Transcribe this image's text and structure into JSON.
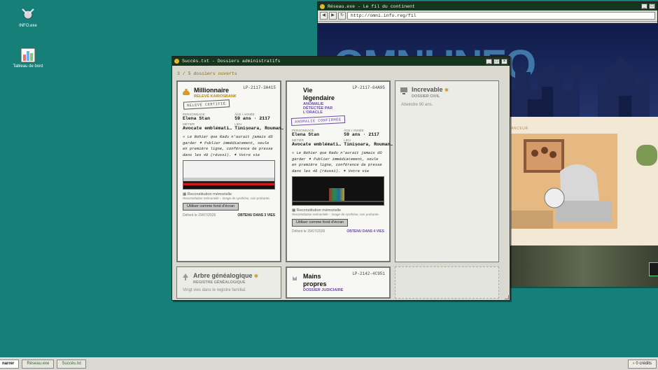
{
  "desktop": {
    "icons": [
      {
        "label": "INFO.exe"
      },
      {
        "label": "Tableau de bord"
      }
    ]
  },
  "browser": {
    "title": "Réseau.exe - Le fil du continent",
    "url": "http://omni.info.reg/fil",
    "banner": "OMNI INFO",
    "section": "ANCEUR"
  },
  "success_window": {
    "title": "Succès.txt - Dossiers administratifs",
    "count_text": "3 / 5 dossiers ouverts",
    "cards": [
      {
        "title": "Millionnaire",
        "id": "LP-2117-3A415",
        "subtitle": "RELEVÉ KAIROSBANK",
        "stamp": "RELEVÉ CERTIFIÉ",
        "labels": [
          "PERSONNAGE",
          "ÂGE / ANNÉE",
          "MÉTIER",
          "LIEU"
        ],
        "character": "Elena Stan",
        "age": "59 ans · 2117",
        "job": "Avocate emblémati…",
        "place": "Timișoara, Rouman…",
        "quote": "« Le Bohier que Radu n'aurait jamais dû garder ✦ Publier immédiatement, seule en première ligne, conférence de presse dans les 48 (réussi). ✦ Votre vie bascule - »",
        "recon_title": "Reconstitution mémorielle",
        "recon_desc": "Reconstitution mémorielle – image de synthèse, non probante.",
        "button": "Utiliser comme fond d'écran",
        "date": "Délivré le 29/07/2026",
        "obtained": "OBTENU DANS 3 VIES"
      },
      {
        "title": "Vie légendaire",
        "id": "LP-2117-64A95",
        "subtitle": "ANOMALIE DÉTECTÉE PAR L'ORACLE",
        "stamp": "ANOMALIE CONFIRMÉE",
        "labels": [
          "PERSONNAGE",
          "ÂGE / ANNÉE",
          "MÉTIER",
          "LIEU"
        ],
        "character": "Elena Stan",
        "age": "59 ans · 2117",
        "job": "Avocate emblémati…",
        "place": "Timișoara, Rouman…",
        "quote": "« Le Bohier que Radu n'aurait jamais dû garder ✦ Publier immédiatement, seule en première ligne, conférence de presse dans les 48 (réussi). ✦ Votre vie bascule - »",
        "recon_title": "Reconstitution mémorielle",
        "recon_desc": "Reconstitution mémorielle – image de synthèse, non probante.",
        "button": "Utiliser comme fond d'écran",
        "date": "Délivré le 29/07/2026",
        "obtained": "OBTENU DANS 4 VIES"
      },
      {
        "title": "Increvable",
        "subtitle": "DOSSIER CIVIL",
        "desc": "Atteindre 90 ans."
      },
      {
        "title": "Arbre généalogique",
        "subtitle": "REGISTRE GÉNÉALOGIQUE",
        "desc": "Vingt vies dans le registre familial."
      },
      {
        "title": "Mains propres",
        "id": "LP-2142-4C951",
        "subtitle": "DOSSIER JUDICIAIRE"
      }
    ]
  },
  "taskbar": {
    "start": "narrer",
    "tasks": [
      "Réseau.exe",
      "Succès.txt"
    ],
    "credits": "0 crédits"
  },
  "colors": {
    "desktop": "#167f78",
    "titlebar": "#14361f",
    "accent_gold": "#b8860b",
    "accent_violet": "#6a4aa6"
  }
}
